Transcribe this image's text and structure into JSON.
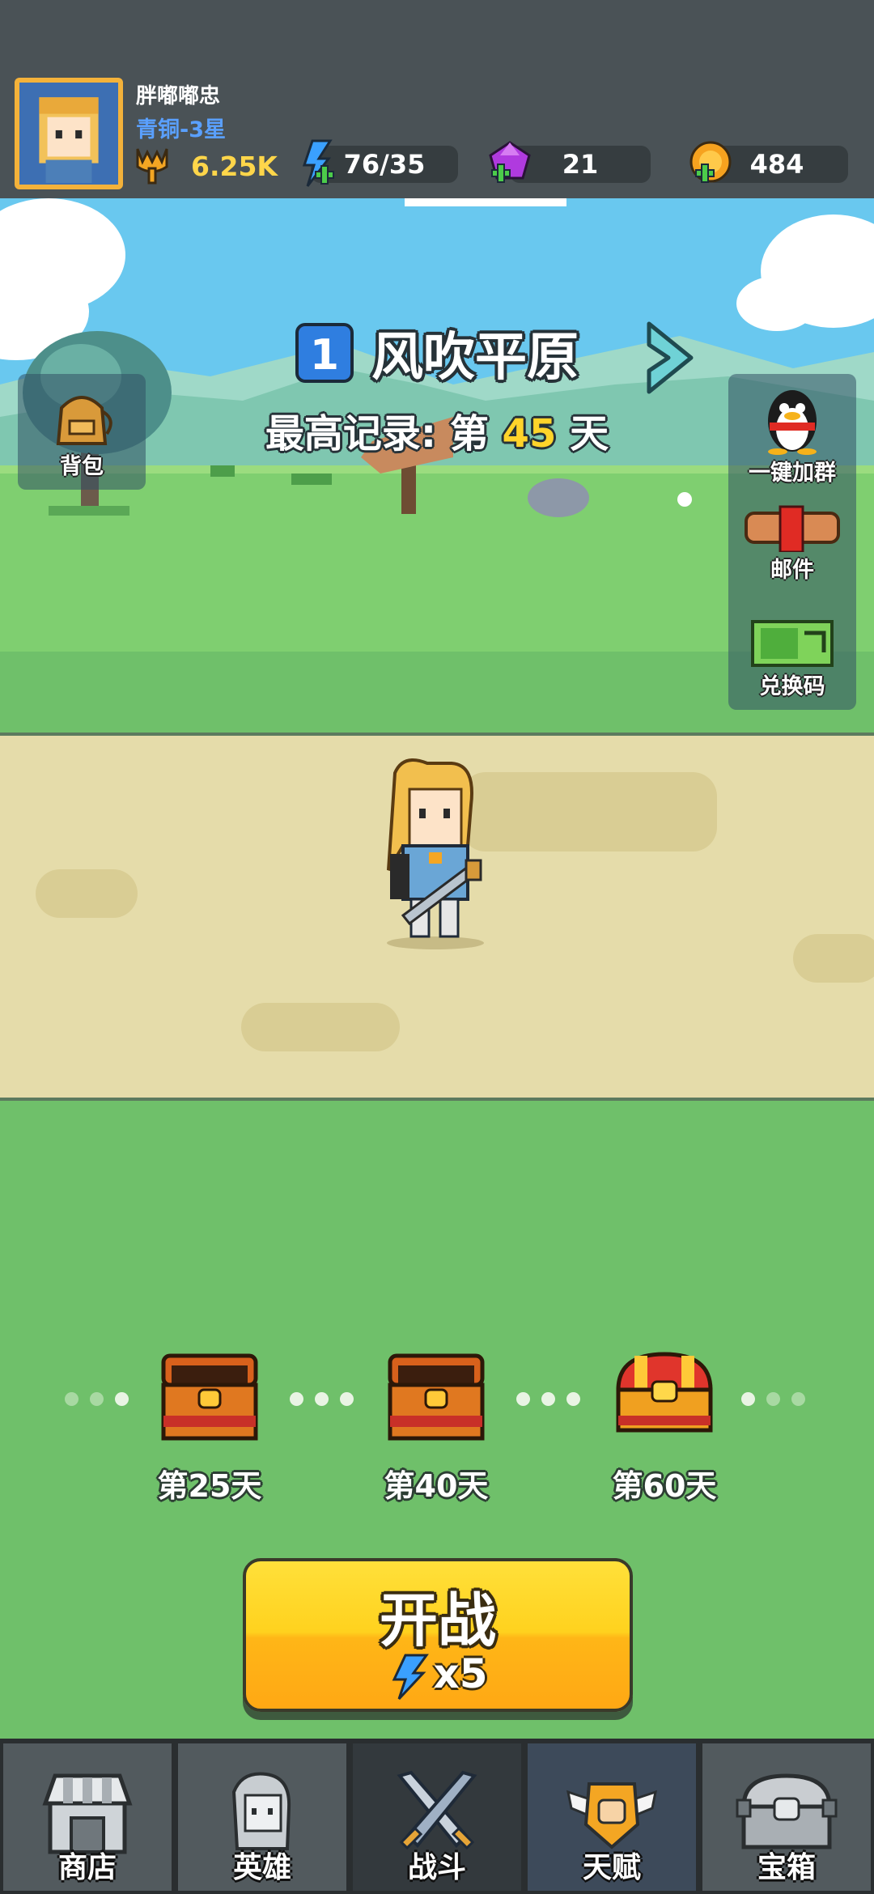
{
  "player": {
    "name": "胖嘟嘟忠",
    "rank": "青铜-3星",
    "power": "6.25K"
  },
  "resources": {
    "energy": "76/35",
    "gems": "21",
    "coins": "484"
  },
  "stage": {
    "number": "1",
    "name": "风吹平原",
    "record_prefix": "最高记录: 第",
    "record_value": "45",
    "record_suffix": "天"
  },
  "side_buttons": {
    "backpack": "背包",
    "join_group": "一键加群",
    "mail": "邮件",
    "redeem": "兑换码"
  },
  "chest_rewards": [
    {
      "label": "第25天",
      "state": "locked"
    },
    {
      "label": "第40天",
      "state": "locked"
    },
    {
      "label": "第60天",
      "state": "closed"
    }
  ],
  "battle_button": {
    "label": "开战",
    "cost": "x5"
  },
  "bottom_nav": [
    {
      "label": "商店",
      "icon": "shop-icon"
    },
    {
      "label": "英雄",
      "icon": "hero-icon"
    },
    {
      "label": "战斗",
      "icon": "crossed-swords-icon",
      "active": true
    },
    {
      "label": "天赋",
      "icon": "fist-wings-icon"
    },
    {
      "label": "宝箱",
      "icon": "treasure-chest-icon"
    }
  ],
  "colors": {
    "topbar": "#4a5256",
    "sky": "#69c8ef",
    "grass": "#6fc06a",
    "road": "#e5dcaa",
    "button_yellow": "#ffd21e",
    "highlight": "#ffd42a"
  }
}
